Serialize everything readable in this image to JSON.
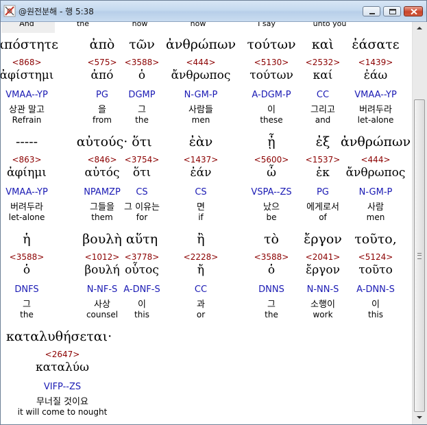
{
  "window": {
    "title": "@원전분해 - 행 5:38"
  },
  "top_row": [
    "And",
    "the",
    "now",
    "now",
    "I say",
    "unto you"
  ],
  "rows": [
    {
      "greek": [
        "ἀπόστητε",
        "ἀπὸ",
        "τῶν",
        "ἀνθρώπων",
        "τούτων",
        "καὶ",
        "ἐάσατε"
      ],
      "numbers": [
        "<868>",
        "<575>",
        "<3588>",
        "<444>",
        "<5130>",
        "<2532>",
        "<1439>"
      ],
      "lemmas": [
        "ἀφίστημι",
        "ἀπό",
        "ὁ",
        "ἄνθρωπος",
        "τούτων",
        "καί",
        "ἐάω"
      ],
      "parsing": [
        "VMAA--YP",
        "PG",
        "DGMP",
        "N-GM-P",
        "A-DGM-P",
        "CC",
        "VMAA--YP"
      ],
      "korean": [
        "상관 말고",
        "을",
        "그",
        "사람들",
        "이",
        "그리고",
        "버려두라"
      ],
      "english": [
        "Refrain",
        "from",
        "the",
        "men",
        "these",
        "and",
        "let-alone"
      ]
    },
    {
      "greek": [
        "-----",
        "αὐτούς·",
        "ὅτι",
        "ἐὰν",
        "ᾖ",
        "ἐξ",
        "ἀνθρώπων"
      ],
      "numbers": [
        "<863>",
        "<846>",
        "<3754>",
        "<1437>",
        "<5600>",
        "<1537>",
        "<444>"
      ],
      "lemmas": [
        "ἀφίημι",
        "αὐτός",
        "ὅτι",
        "ἐάν",
        "ὦ",
        "ἐκ",
        "ἄνθρωπος"
      ],
      "parsing": [
        "VMAA--YP",
        "NPAMZP",
        "CS",
        "CS",
        "VSPA--ZS",
        "PG",
        "N-GM-P"
      ],
      "korean": [
        "버려두라",
        "그들을",
        "그 이유는",
        "면",
        "났으",
        "에게로서",
        "사람"
      ],
      "english": [
        "let-alone",
        "them",
        "for",
        "if",
        "be",
        "of",
        "men"
      ]
    },
    {
      "greek": [
        "ἡ",
        "βουλὴ",
        "αὕτη",
        "ἢ",
        "τὸ",
        "ἔργον",
        "τοῦτο,"
      ],
      "numbers": [
        "<3588>",
        "<1012>",
        "<3778>",
        "<2228>",
        "<3588>",
        "<2041>",
        "<5124>"
      ],
      "lemmas": [
        "ὁ",
        "βουλή",
        "οὗτος",
        "ἤ",
        "ὁ",
        "ἔργον",
        "τοῦτο"
      ],
      "parsing": [
        "DNFS",
        "N-NF-S",
        "A-DNF-S",
        "CC",
        "DNNS",
        "N-NN-S",
        "A-DNN-S"
      ],
      "korean": [
        "그",
        "사상",
        "이",
        "과",
        "그",
        "소행이",
        "이"
      ],
      "english": [
        "the",
        "counsel",
        "this",
        "or",
        "the",
        "work",
        "this"
      ]
    },
    {
      "greek": [
        "καταλυθήσεται·"
      ],
      "numbers": [
        "<2647>"
      ],
      "lemmas": [
        "καταλύω"
      ],
      "parsing": [
        "VIFP--ZS"
      ],
      "korean": [
        "무너질 것이요"
      ],
      "english": [
        "it will come to nought"
      ]
    }
  ],
  "colors": {
    "number": "#8b0000",
    "parsing": "#1a1ab4",
    "close_button": "#c8442a"
  },
  "icons": [
    "app-icon",
    "minimize-icon",
    "maximize-icon",
    "close-icon",
    "scroll-up-icon",
    "scroll-down-icon",
    "scroll-grip-icon"
  ]
}
